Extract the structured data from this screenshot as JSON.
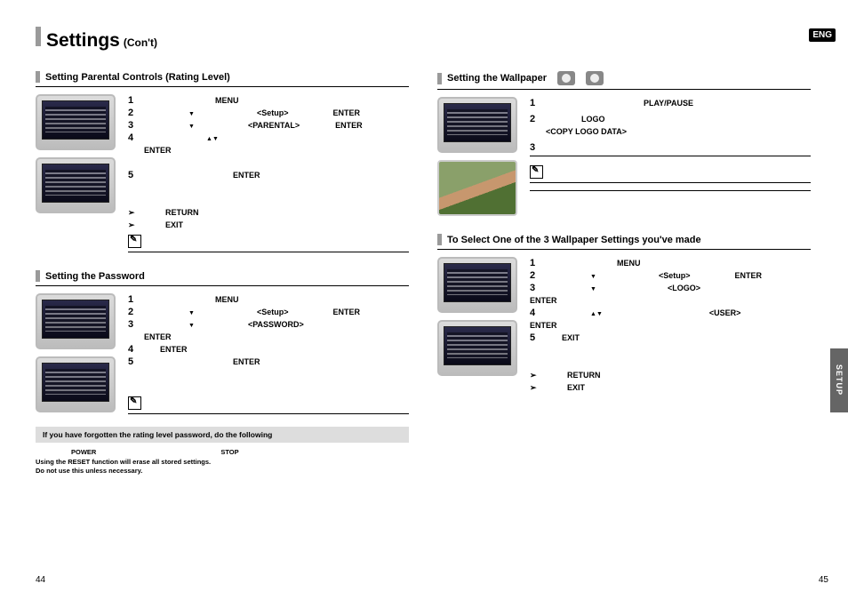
{
  "lang_badge": "ENG",
  "side_tab": "SETUP",
  "title": {
    "main": "Settings",
    "sub": "(Con't)"
  },
  "page_left": "44",
  "page_right": "45",
  "left": {
    "sec1": {
      "title": "Setting Parental Controls (Rating Level)",
      "menu": "MENU",
      "setup": "<Setup>",
      "enter": "ENTER",
      "parental": "<PARENTAL>",
      "return": "RETURN",
      "exit": "EXIT"
    },
    "sec2": {
      "title": "Setting the Password",
      "menu": "MENU",
      "setup": "<Setup>",
      "enter": "ENTER",
      "password": "<PASSWORD>"
    },
    "graybox": "If you have forgotten the rating level password, do the following",
    "foot_power": "POWER",
    "foot_stop": "STOP",
    "foot_line1": "Using the RESET function will erase all stored settings.",
    "foot_line2": "Do not use this unless necessary."
  },
  "right": {
    "sec1": {
      "title": "Setting the Wallpaper",
      "playpause": "PLAY/PAUSE",
      "logo": "LOGO",
      "copylogo": "<COPY LOGO DATA>"
    },
    "sec2": {
      "title": "To Select One of the 3 Wallpaper Settings you've made",
      "menu": "MENU",
      "setup": "<Setup>",
      "enter": "ENTER",
      "logo": "<LOGO>",
      "user": "<USER>",
      "exit": "EXIT",
      "return": "RETURN"
    }
  },
  "nums": {
    "n1": "1",
    "n2": "2",
    "n3": "3",
    "n4": "4",
    "n5": "5"
  }
}
